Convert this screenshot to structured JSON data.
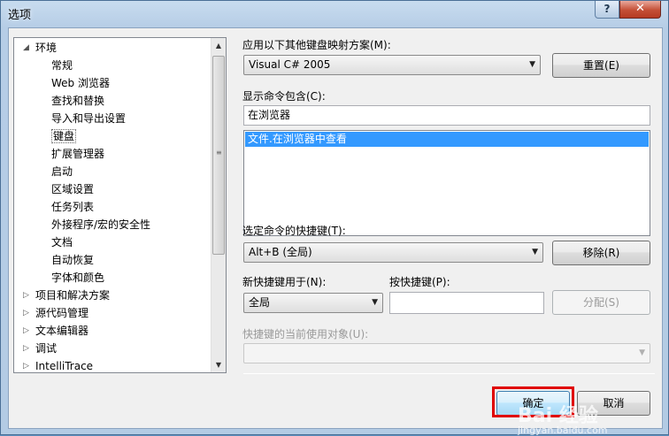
{
  "window": {
    "title": "选项",
    "help_glyph": "?",
    "close_glyph": "✕"
  },
  "tree": {
    "items": [
      {
        "label": "环境",
        "expanded": true,
        "level": 0
      },
      {
        "label": "常规",
        "level": 1
      },
      {
        "label": "Web 浏览器",
        "level": 1
      },
      {
        "label": "查找和替换",
        "level": 1
      },
      {
        "label": "导入和导出设置",
        "level": 1
      },
      {
        "label": "键盘",
        "level": 1,
        "selected": true
      },
      {
        "label": "扩展管理器",
        "level": 1
      },
      {
        "label": "启动",
        "level": 1
      },
      {
        "label": "区域设置",
        "level": 1
      },
      {
        "label": "任务列表",
        "level": 1
      },
      {
        "label": "外接程序/宏的安全性",
        "level": 1
      },
      {
        "label": "文档",
        "level": 1
      },
      {
        "label": "自动恢复",
        "level": 1
      },
      {
        "label": "字体和颜色",
        "level": 1
      },
      {
        "label": "项目和解决方案",
        "expanded": false,
        "level": 0
      },
      {
        "label": "源代码管理",
        "expanded": false,
        "level": 0
      },
      {
        "label": "文本编辑器",
        "expanded": false,
        "level": 0
      },
      {
        "label": "调试",
        "expanded": false,
        "level": 0
      },
      {
        "label": "IntelliTrace",
        "expanded": false,
        "level": 0
      }
    ]
  },
  "keyboard": {
    "mapping_scheme_label": "应用以下其他键盘映射方案(M):",
    "mapping_scheme_value": "Visual C# 2005",
    "reset_button": "重置(E)",
    "show_commands_label": "显示命令包含(C):",
    "show_commands_value": "在浏览器",
    "commands_list": [
      "文件.在浏览器中查看"
    ],
    "shortcuts_label": "选定命令的快捷键(T):",
    "shortcuts_value": "Alt+B (全局)",
    "remove_button": "移除(R)",
    "use_new_shortcut_label": "新快捷键用于(N):",
    "use_new_shortcut_value": "全局",
    "press_shortcut_label": "按快捷键(P):",
    "press_shortcut_value": "",
    "assign_button": "分配(S)",
    "currently_used_label": "快捷键的当前使用对象(U):",
    "currently_used_value": ""
  },
  "footer": {
    "ok_button": "确定",
    "cancel_button": "取消"
  },
  "watermark": {
    "text": "Bai 经验",
    "url": "jingyan.baidu.com"
  },
  "colors": {
    "selection": "#3399ff",
    "highlight_box": "#e00000"
  }
}
